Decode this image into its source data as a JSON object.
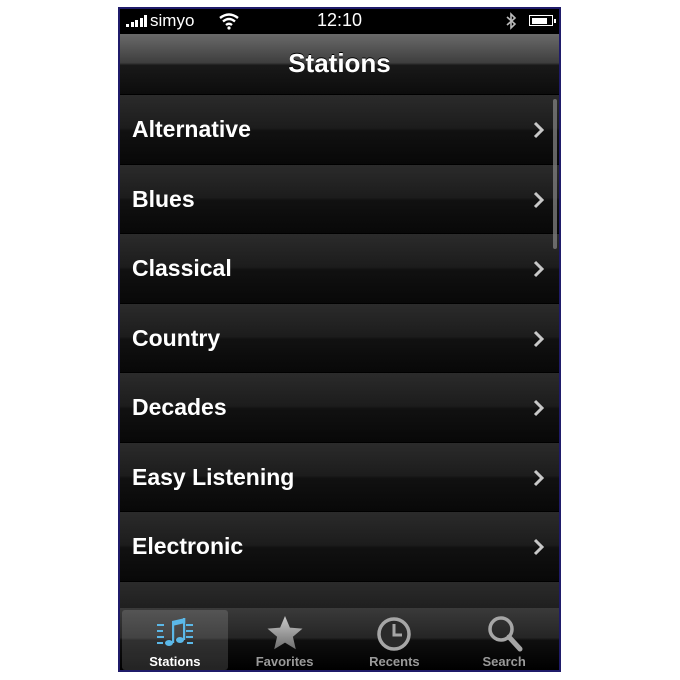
{
  "status_bar": {
    "carrier": "simyo",
    "time": "12:10"
  },
  "nav": {
    "title": "Stations"
  },
  "stations": [
    {
      "label": "Alternative"
    },
    {
      "label": "Blues"
    },
    {
      "label": "Classical"
    },
    {
      "label": "Country"
    },
    {
      "label": "Decades"
    },
    {
      "label": "Easy Listening"
    },
    {
      "label": "Electronic"
    },
    {
      "label": ""
    }
  ],
  "tabs": [
    {
      "label": "Stations",
      "icon": "music-notes-icon",
      "active": true
    },
    {
      "label": "Favorites",
      "icon": "star-icon",
      "active": false
    },
    {
      "label": "Recents",
      "icon": "clock-icon",
      "active": false
    },
    {
      "label": "Search",
      "icon": "search-icon",
      "active": false
    }
  ],
  "colors": {
    "active_icon": "#5bb8e8",
    "inactive": "#9a9a9a"
  }
}
